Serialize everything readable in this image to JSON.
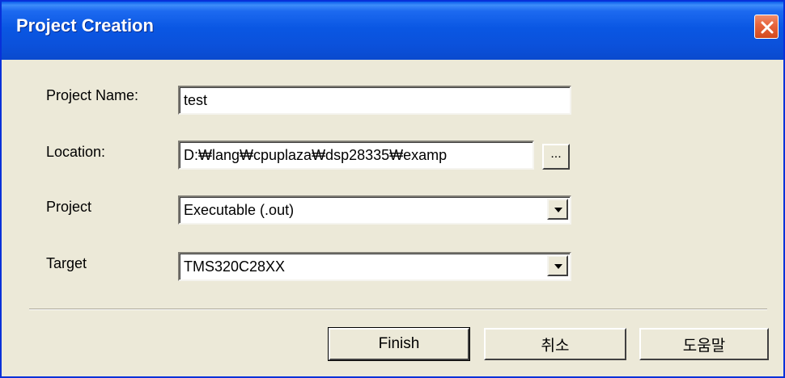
{
  "window": {
    "title": "Project Creation"
  },
  "form": {
    "project_name_label": "Project Name:",
    "project_name_value": "test",
    "location_label": "Location:",
    "location_value": "D:₩lang₩cpuplaza₩dsp28335₩examp",
    "browse_label": "...",
    "project_label": "Project",
    "project_value": "Executable (.out)",
    "target_label": "Target",
    "target_value": "TMS320C28XX"
  },
  "buttons": {
    "finish": "Finish",
    "cancel": "취소",
    "help": "도움말"
  },
  "icons": {
    "close": "close-icon",
    "dropdown": "chevron-down-icon"
  },
  "colors": {
    "titlebar": "#0A57E3",
    "close_button": "#E8663E",
    "dialog_bg": "#ECE9D8"
  }
}
